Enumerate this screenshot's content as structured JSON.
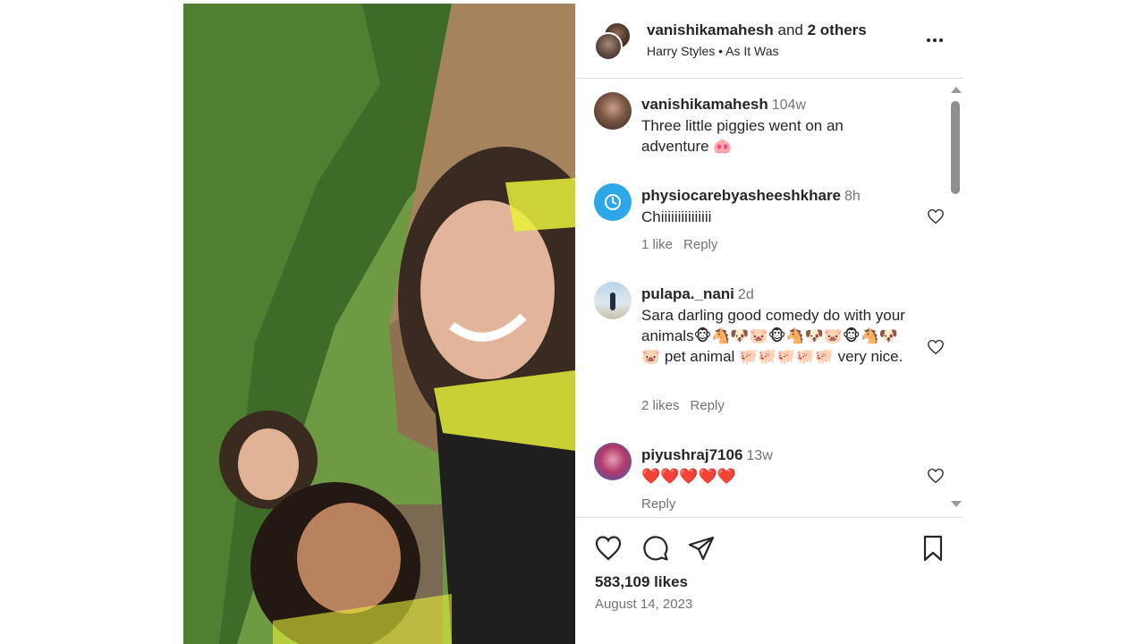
{
  "header": {
    "username": "vanishikamahesh",
    "and_text": "and",
    "others": "2 others",
    "music": "Harry Styles • As It Was"
  },
  "comments": [
    {
      "username": "vanishikamahesh",
      "time": "104w",
      "text": "Three little piggies went on an adventure 🐽"
    },
    {
      "username": "physiocarebyasheeshkhare",
      "time": "8h",
      "text": "Chiiiiiiiiiiiiiii",
      "likes": "1 like",
      "reply": "Reply"
    },
    {
      "username": "pulapa._nani",
      "time": "2d",
      "text": "Sara darling good comedy do with your animals🐵🐴🐶🐷🐵🐴🐶🐷🐵🐴🐶🐷 pet animal 🐖🐖🐖🐖🐖 very nice.",
      "likes": "2 likes",
      "reply": "Reply"
    },
    {
      "username": "piyushraj7106",
      "time": "13w",
      "text": "❤️❤️❤️❤️❤️",
      "reply": "Reply"
    }
  ],
  "footer": {
    "likes": "583,109 likes",
    "date": "August 14, 2023"
  },
  "icons": {
    "more": "more-options-icon",
    "like": "heart-icon",
    "comment": "comment-icon",
    "share": "share-icon",
    "save": "bookmark-icon"
  }
}
